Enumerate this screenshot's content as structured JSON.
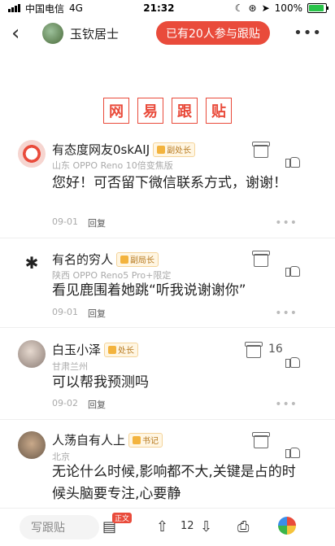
{
  "status": {
    "carrier": "中国电信",
    "network": "4G",
    "time": "21:32",
    "battery": "100%"
  },
  "nav": {
    "username": "玉钦居士",
    "participants": "已有20人参与跟贴"
  },
  "banner": [
    "网",
    "易",
    "跟",
    "贴"
  ],
  "comments": [
    {
      "name": "有态度网友0skAIJ",
      "badge": "副处长",
      "meta": "山东 OPPO Reno 10倍变焦版",
      "text": "您好！可否留下微信联系方式，谢谢！",
      "time": "09-01",
      "reply": "回复"
    },
    {
      "name": "有名的穷人",
      "badge": "副局长",
      "meta": "陕西 OPPO Reno5 Pro+限定",
      "text": "看见鹿围着她跳“听我说谢谢你”",
      "time": "09-01",
      "reply": "回复"
    },
    {
      "name": "白玉小泽",
      "badge": "处长",
      "meta": "甘肃兰州",
      "text": "可以帮我预测吗",
      "time": "09-02",
      "reply": "回复",
      "likes": "16"
    },
    {
      "name": "人荡自有人上",
      "badge": "书记",
      "meta": "北京",
      "text": "无论什么时候,影响都不大,关键是占的时候头脑要专注,心要静",
      "time": "",
      "reply": ""
    }
  ],
  "bottom": {
    "placeholder": "写跟贴",
    "tag": "正文",
    "count": "12"
  }
}
